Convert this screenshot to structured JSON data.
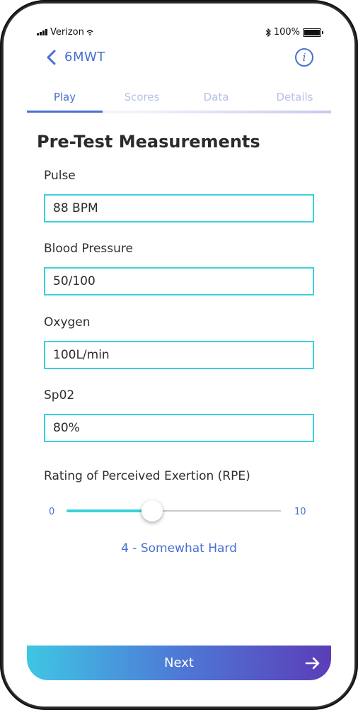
{
  "status_bar": {
    "carrier": "Verizon",
    "battery": "100%"
  },
  "header": {
    "title": "6MWT",
    "back_icon": "chevron-left-icon",
    "info_icon": "info-icon",
    "info_glyph": "i"
  },
  "tabs": [
    {
      "label": "Play",
      "active": true
    },
    {
      "label": "Scores",
      "active": false
    },
    {
      "label": "Data",
      "active": false
    },
    {
      "label": "Details",
      "active": false
    }
  ],
  "section": {
    "title": "Pre-Test Measurements"
  },
  "fields": {
    "pulse": {
      "label": "Pulse",
      "value": "88 BPM"
    },
    "blood_pressure": {
      "label": "Blood Pressure",
      "value": "50/100"
    },
    "oxygen": {
      "label": "Oxygen",
      "value": "100L/min"
    },
    "spo2": {
      "label": "Sp02",
      "value": "80%"
    }
  },
  "rpe": {
    "label": "Rating of Perceived Exertion (RPE)",
    "min": "0",
    "max": "10",
    "value": 4,
    "value_text": "4 - Somewhat Hard"
  },
  "footer": {
    "next_label": "Next",
    "next_icon": "arrow-right-icon"
  },
  "colors": {
    "accent": "#4a6fd0",
    "input_border": "#3ad1dc",
    "gradient_start": "#3fc6e4",
    "gradient_end": "#5b3db8"
  }
}
